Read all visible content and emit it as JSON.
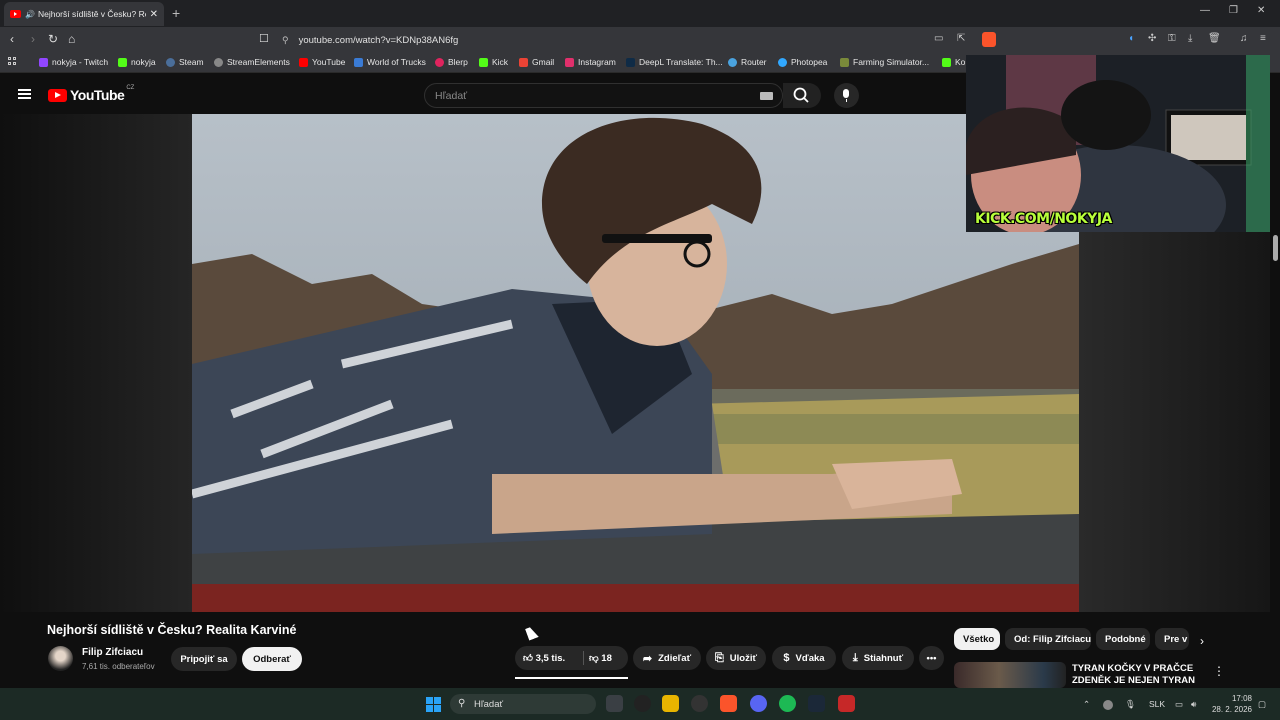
{
  "browser": {
    "tab_title": "Nejhorší sídliště v Česku? Re",
    "url": "youtube.com/watch?v=KDNp38AN6fg",
    "bookmarks": [
      "nokyja - Twitch",
      "nokyja",
      "Steam",
      "StreamElements",
      "YouTube",
      "World of Trucks",
      "Blerp",
      "Kick",
      "Gmail",
      "Instagram",
      "DeepL Translate: Th...",
      "Router",
      "Photopea",
      "Farming Simulator...",
      "Ko"
    ],
    "bookmark_colors": [
      "#9146ff",
      "#53fc18",
      "#1b2838",
      "#1f1f1f",
      "#ff0000",
      "#3a7bd5",
      "#e0245e",
      "#53fc18",
      "#ea4335",
      "#e1306c",
      "#0f2b46",
      "#4aa3df",
      "#31a8ff",
      "#7a8a3a",
      "#53fc18"
    ]
  },
  "youtube": {
    "logo_text": "YouTube",
    "country": "CZ",
    "search_placeholder": "Hľadať",
    "video_title": "Nejhorší sídliště v Česku? Realita Karviné",
    "channel_name": "Filip Zifciacu",
    "subscribers": "7,61 tis. odberateľov",
    "join_label": "Pripojiť sa",
    "subscribe_label": "Odberať",
    "likes": "3,5 tis.",
    "dislikes": "18",
    "share_label": "Zdieľať",
    "save_label": "Uložiť",
    "thanks_label": "Vďaka",
    "download_label": "Stiahnuť",
    "chips": [
      "Všetko",
      "Od: Filip Zifciacu",
      "Podobné",
      "Pre v"
    ],
    "rec_title": "TYRAN KOČKY V PRAČCE ZDENĚK JE NEJEN TYRAN ...",
    "accent_red": "#ff0000"
  },
  "overlay": {
    "kick_text": "KICK.COM/NOKYJA"
  },
  "taskbar": {
    "search_placeholder": "Hľadať",
    "language": "SLK",
    "time": "17:08",
    "date": "28. 2. 2026"
  }
}
